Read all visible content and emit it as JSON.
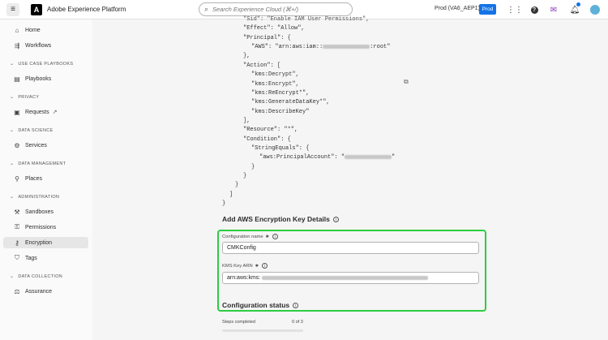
{
  "header": {
    "app_title": "Adobe Experience Platform",
    "search_placeholder": "Search Experience Cloud (⌘+/)",
    "sandbox": "Prod (VA6_AEP1)",
    "prod_label": "Prod"
  },
  "sidebar": {
    "items": [
      {
        "label": "Home",
        "icon": "home-icon"
      },
      {
        "label": "Workflows",
        "icon": "workflows-icon"
      },
      {
        "label": "Playbooks",
        "icon": "playbooks-icon"
      },
      {
        "label": "Requests",
        "icon": "requests-icon"
      },
      {
        "label": "Services",
        "icon": "services-icon"
      },
      {
        "label": "Places",
        "icon": "places-icon"
      },
      {
        "label": "Sandboxes",
        "icon": "sandboxes-icon"
      },
      {
        "label": "Permissions",
        "icon": "permissions-icon"
      },
      {
        "label": "Encryption",
        "icon": "encryption-icon",
        "active": true
      },
      {
        "label": "Tags",
        "icon": "tags-icon"
      },
      {
        "label": "Assurance",
        "icon": "assurance-icon"
      }
    ],
    "sections": {
      "use_case_playbooks": "USE CASE PLAYBOOKS",
      "privacy": "PRIVACY",
      "data_science": "DATA SCIENCE",
      "data_management": "DATA MANAGEMENT",
      "administration": "ADMINISTRATION",
      "data_collection": "DATA COLLECTION"
    }
  },
  "policy_json": {
    "top_line": "\"Sid\": \"Enable IAM User Permissions\",",
    "effect": "\"Effect\": \"Allow\",",
    "principal_open": "\"Principal\": {",
    "aws_prefix": "\"AWS\": \"arn:aws:iam::",
    "aws_suffix": ":root\"",
    "close_brace_comma": "},",
    "action_open": "\"Action\": [",
    "actions": [
      "\"kms:Decrypt\",",
      "\"kms:Encrypt\",",
      "\"kms:ReEncrypt*\",",
      "\"kms:GenerateDataKey*\",",
      "\"kms:DescribeKey\""
    ],
    "action_close": "],",
    "resource": "\"Resource\": \"*\",",
    "condition_open": "\"Condition\": {",
    "string_equals_open": "\"StringEquals\": {",
    "principal_account_prefix": "\"aws:PrincipalAccount\": \"",
    "principal_account_suffix": "\"",
    "close1": "}",
    "close2": "}",
    "close3": "}",
    "close4": "]",
    "close5": "}"
  },
  "form": {
    "section_title": "Add AWS Encryption Key Details",
    "config_name_label": "Configuration name",
    "config_name_value": "CMKConfig",
    "kms_arn_label": "KMS Key ARN",
    "kms_arn_prefix": "arn:aws:kms:"
  },
  "status": {
    "title": "Configuration status",
    "steps_label": "Steps completed",
    "steps_count": "0 of 3",
    "progress": 0
  },
  "colors": {
    "accent": "#1473e6",
    "highlight": "#2ecc40"
  }
}
